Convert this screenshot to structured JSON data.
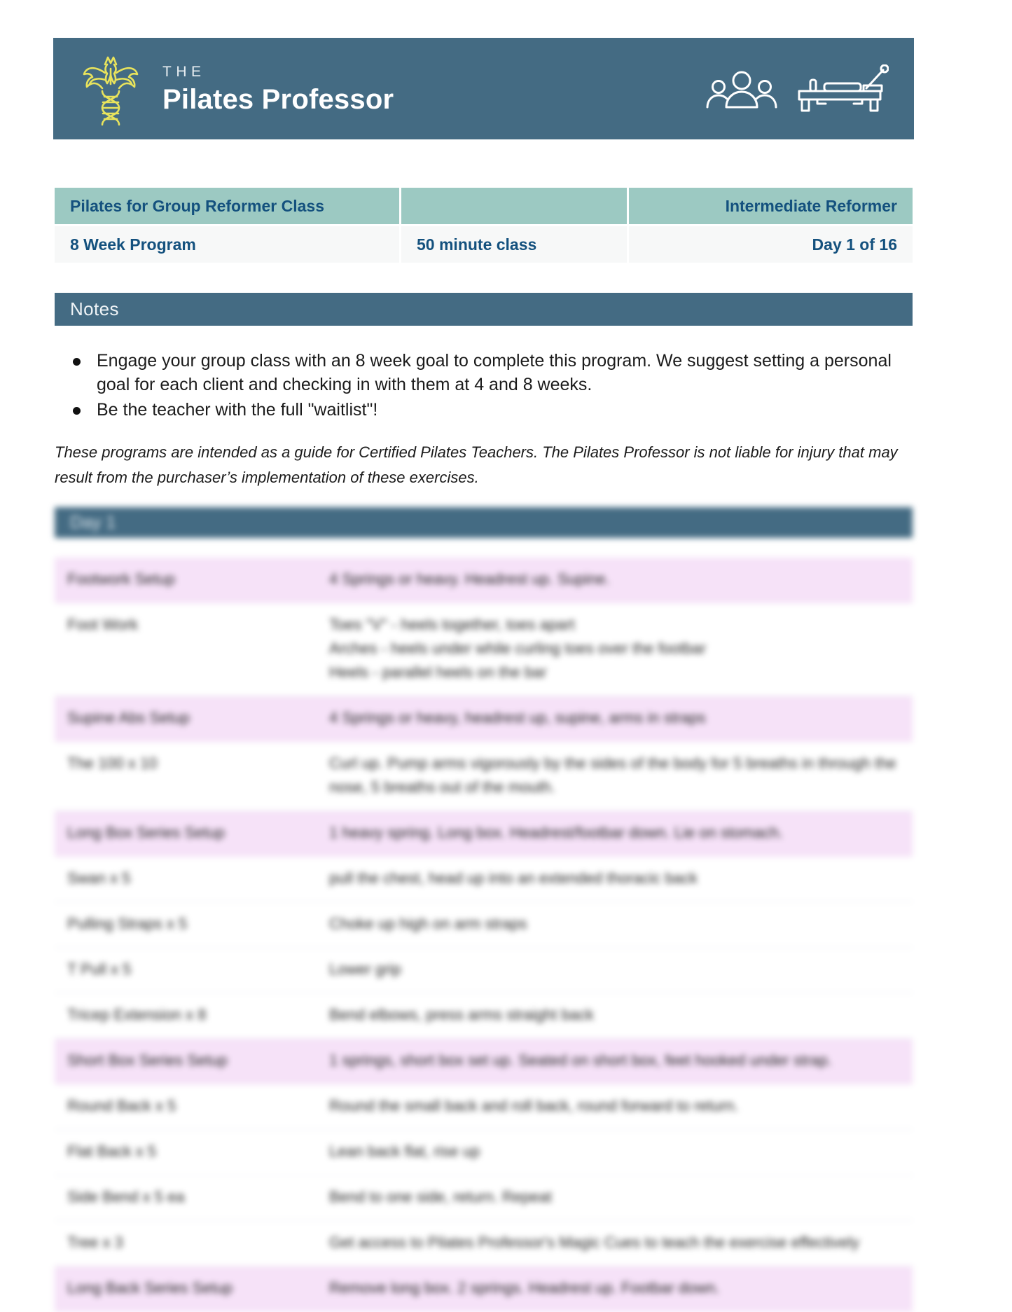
{
  "brand": {
    "eyebrow": "THE",
    "name": "Pilates Professor",
    "logo_icon": "phoenix-dna-logo-icon",
    "people_icon": "group-of-people-icon",
    "reformer_icon": "pilates-reformer-icon",
    "header_color": "#446b83",
    "logo_color": "#e8e35c"
  },
  "info": {
    "class_title": "Pilates for Group Reformer Class",
    "middle_top": "",
    "level": "Intermediate Reformer",
    "program_length": "8 Week Program",
    "class_duration": "50 minute class",
    "day_counter": "Day 1 of 16",
    "teal_color": "#9cc9c2",
    "text_color": "#14517e"
  },
  "notes": {
    "heading": "Notes",
    "bullets": [
      "Engage your group class with an 8 week goal to complete this program.  We suggest setting a personal goal for each client and checking in with them at 4 and 8 weeks.",
      "Be the teacher with the full \"waitlist\"!"
    ],
    "disclaimer": "These programs are intended as a guide for Certified Pilates Teachers.  The Pilates Professor is not liable for injury that may result from the purchaser’s implementation of these exercises."
  },
  "day_section": {
    "title": "Day 1",
    "setup_row_color": "#f6e2f8",
    "rows": [
      {
        "kind": "setup",
        "exercise": "Footwork Setup",
        "detail": "4 Springs or heavy.  Headrest up.  Supine."
      },
      {
        "kind": "work",
        "exercise": "Foot Work",
        "detail": "Toes \"V\" - heels together, toes apart\nArches - heels under while curling toes over the footbar\nHeels - parallel heels on the bar"
      },
      {
        "kind": "setup",
        "exercise": "Supine Abs Setup",
        "detail": "4 Springs or heavy, headrest up, supine, arms in straps"
      },
      {
        "kind": "work",
        "exercise": "The 100 x 10",
        "detail": "Curl up. Pump arms vigorously by the sides of the body for 5 breaths in through the nose, 5 breaths out of the mouth."
      },
      {
        "kind": "setup",
        "exercise": "Long Box Series Setup",
        "detail": "1 heavy spring.  Long box.  Headrest/footbar down.  Lie on stomach."
      },
      {
        "kind": "work",
        "exercise": "Swan x 5",
        "detail": "pull the chest, head up into an extended thoracic back"
      },
      {
        "kind": "work",
        "exercise": "Pulling Straps x 5",
        "detail": "Choke up high on arm straps"
      },
      {
        "kind": "work",
        "exercise": "T Pull x 5",
        "detail": "Lower grip"
      },
      {
        "kind": "work",
        "exercise": "Tricep Extension x 8",
        "detail": "Bend elbows, press arms straight back"
      },
      {
        "kind": "setup",
        "exercise": "Short Box Series Setup",
        "detail": "1 springs, short box set up.  Seated on short box, feet hooked under strap."
      },
      {
        "kind": "work",
        "exercise": "Round Back x 5",
        "detail": "Round the small back and roll back, round forward to return."
      },
      {
        "kind": "work",
        "exercise": "Flat Back x 5",
        "detail": "Lean back flat, rise up"
      },
      {
        "kind": "work",
        "exercise": "Side Bend x 5 ea",
        "detail": "Bend to one side, return. Repeat"
      },
      {
        "kind": "work",
        "exercise": "Tree x 3",
        "detail": "Get access to Pilates Professor's Magic Cues to teach the exercise effectively"
      },
      {
        "kind": "setup",
        "exercise": "Long Back Series Setup",
        "detail": "Remove long box.  2 springs.  Headrest up.  Footbar down."
      }
    ]
  }
}
